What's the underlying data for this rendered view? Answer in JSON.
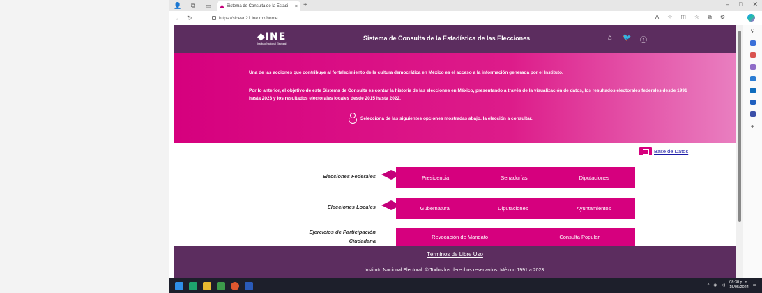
{
  "browser": {
    "tab_title": "Sistema de Consulta de la Estadi",
    "tab_close": "×",
    "new_tab": "+",
    "url": "https://siceen21.ine.mx/home",
    "window_controls": [
      "–",
      "□",
      "✕"
    ]
  },
  "header": {
    "logo_text": "INE",
    "logo_subtext": "Instituto Nacional Electoral",
    "title": "Sistema de Consulta de la Estadística de las Elecciones",
    "social_icons": [
      "home-icon",
      "twitter-icon",
      "facebook-icon"
    ]
  },
  "banner": {
    "paragraph1": "Una de las acciones que contribuye al fortalecimiento de la cultura democrática en México es el acceso a la información generada por el Instituto.",
    "paragraph2": "Por lo anterior, el objetivo de este Sistema de Consulta es contar la historia de las elecciones en México, presentando a través de la visualización de datos, los resultados electorales federales desde 1991 hasta 2023 y los resultados electorales locales desde 2015 hasta 2022.",
    "instruction": "Selecciona de las siguientes opciones mostradas abajo, la elección a consultar."
  },
  "database_link": "Base de Datos",
  "federal": {
    "label": "Elecciones Federales",
    "buttons": [
      "Presidencia",
      "Senadurías",
      "Diputaciones"
    ]
  },
  "local": {
    "label": "Elecciones Locales",
    "buttons": [
      "Gubernatura",
      "Diputaciones",
      "Ayuntamientos"
    ]
  },
  "citizen": {
    "label_line1": "Ejercicios de Participación",
    "label_line2": "Ciudadana",
    "buttons": [
      "Revocación de Mandato",
      "Consulta Popular"
    ]
  },
  "footer": {
    "terms": "Términos de Libre Uso",
    "copyright": "Instituto Nacional Electoral. © Todos los derechos reservados, México 1991 a 2023."
  },
  "taskbar": {
    "time": "08:30 p. m.",
    "date": "15/05/2024"
  },
  "colors": {
    "brand_purple": "#5c2d5f",
    "brand_pink": "#d6007e"
  }
}
